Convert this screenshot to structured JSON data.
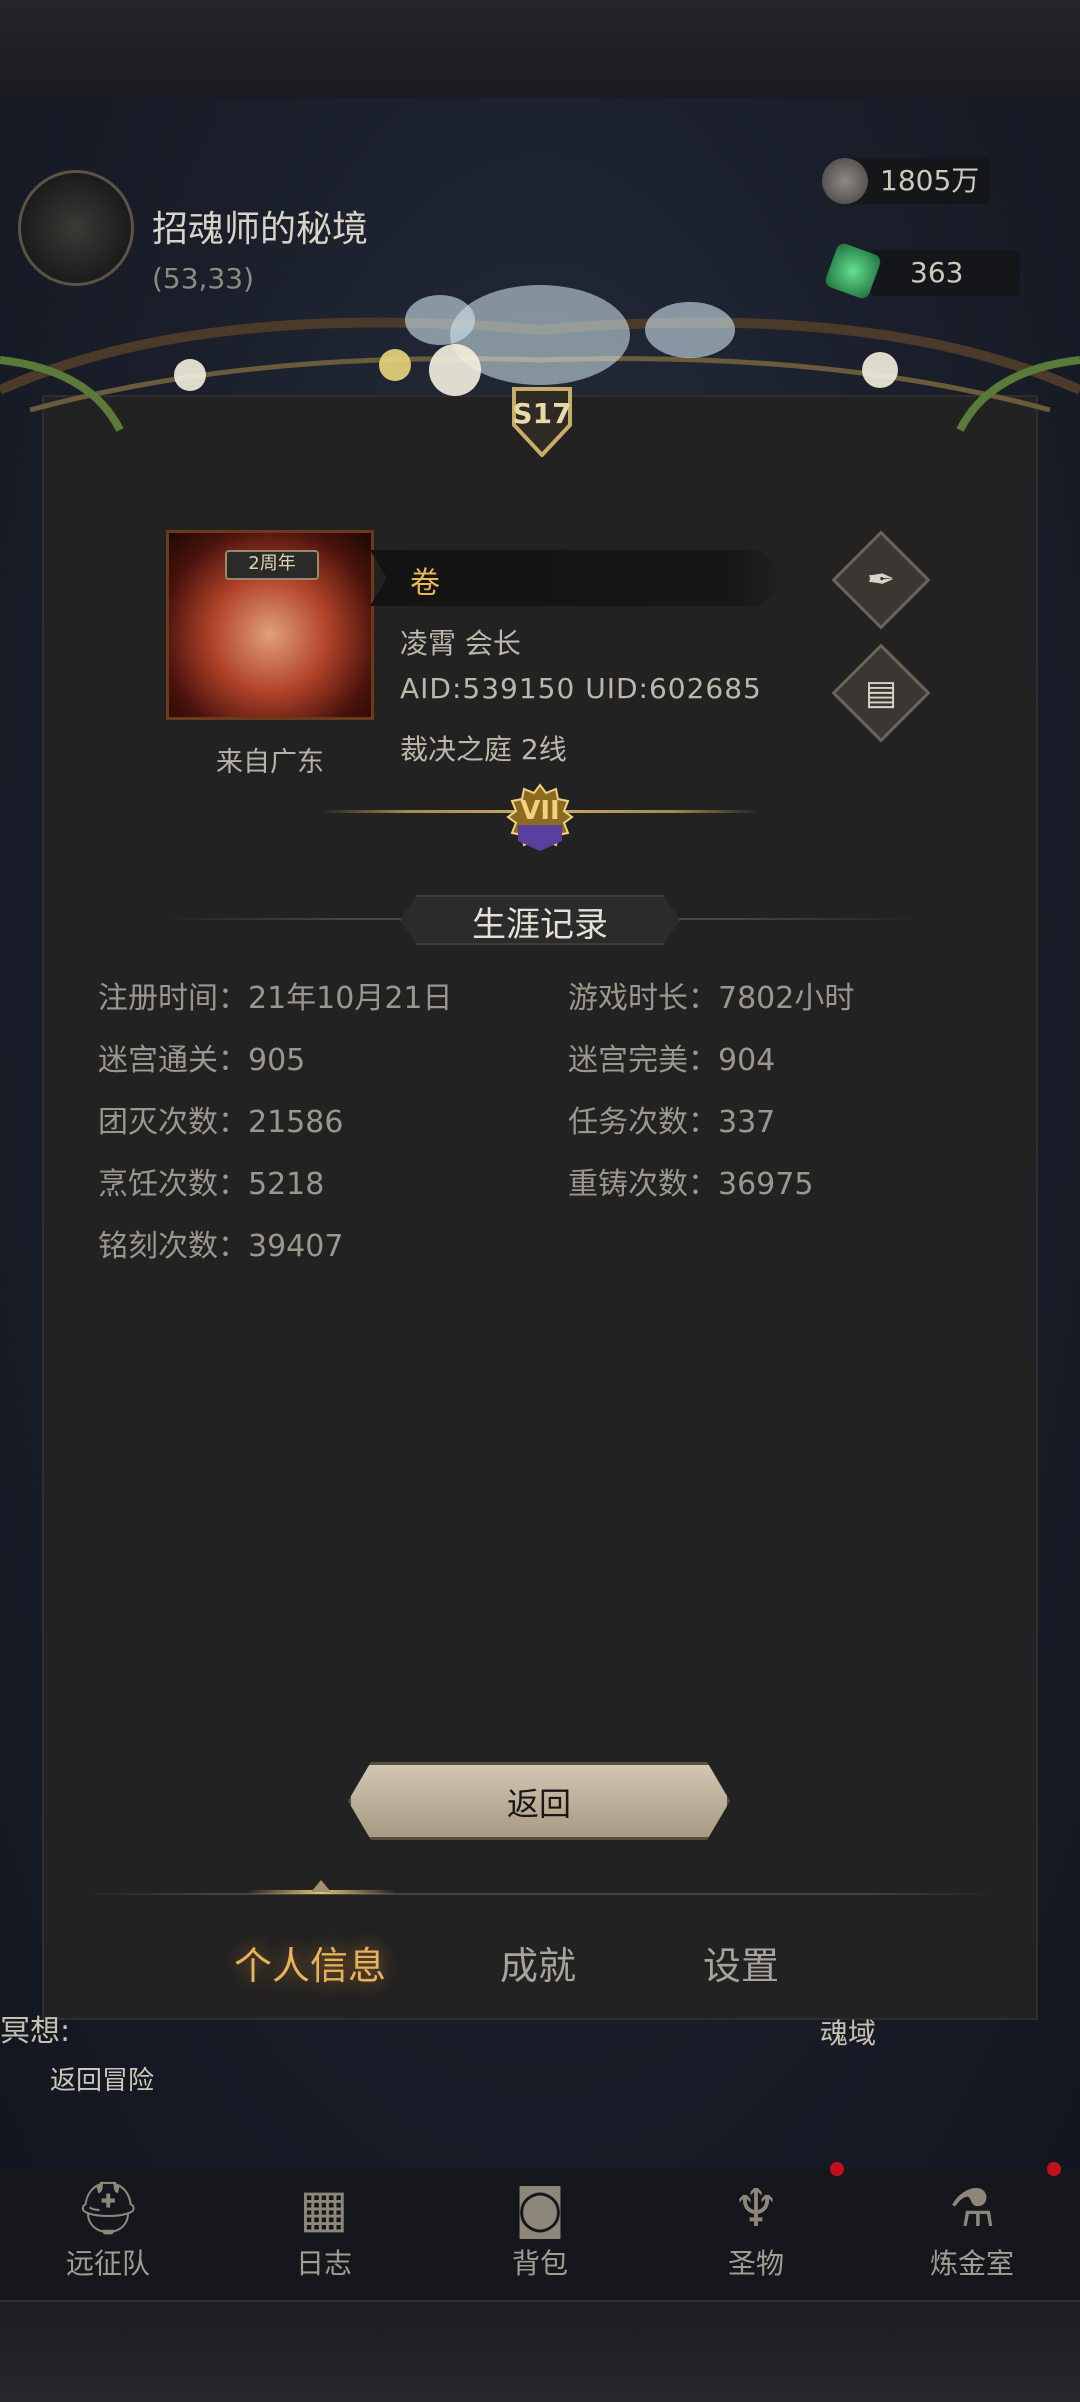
{
  "location": {
    "name": "招魂师的秘境",
    "coords": "(53,33)"
  },
  "resources": [
    {
      "icon": "silver-coin-icon",
      "value": "1805万"
    },
    {
      "icon": "green-gem-icon",
      "value": "363"
    }
  ],
  "season": {
    "label": "S17"
  },
  "profile": {
    "portrait_tag": "2周年",
    "name": "卷",
    "guild_line": "凌霄  会长",
    "id_line": "AID:539150 UID:602685",
    "server_line": "裁决之庭  2线",
    "origin": "来自广东",
    "rank": "VII"
  },
  "career": {
    "title": "生涯记录",
    "stats": [
      {
        "label": "注册时间：",
        "value": "21年10月21日"
      },
      {
        "label": "游戏时长：",
        "value": "7802小时"
      },
      {
        "label": "迷宫通关：",
        "value": "905"
      },
      {
        "label": "迷宫完美：",
        "value": "904"
      },
      {
        "label": "团灭次数：",
        "value": "21586"
      },
      {
        "label": "任务次数：",
        "value": "337"
      },
      {
        "label": "烹饪次数：",
        "value": "5218"
      },
      {
        "label": "重铸次数：",
        "value": "36975"
      },
      {
        "label": "铭刻次数：",
        "value": "39407"
      }
    ]
  },
  "buttons": {
    "back": "返回"
  },
  "tabs": [
    {
      "label": "个人信息",
      "active": true
    },
    {
      "label": "成就",
      "active": false
    },
    {
      "label": "设置",
      "active": false
    }
  ],
  "background": {
    "return_adventure": "返回冒险",
    "left_snippet": "冥想:",
    "right_snippet": "魂域"
  },
  "bottom_nav": [
    {
      "label": "远征队",
      "icon": "viking-helmet-icon"
    },
    {
      "label": "日志",
      "icon": "scroll-map-icon"
    },
    {
      "label": "背包",
      "icon": "backpack-icon"
    },
    {
      "label": "圣物",
      "icon": "chalice-icon"
    },
    {
      "label": "炼金室",
      "icon": "alchemy-icon"
    }
  ]
}
